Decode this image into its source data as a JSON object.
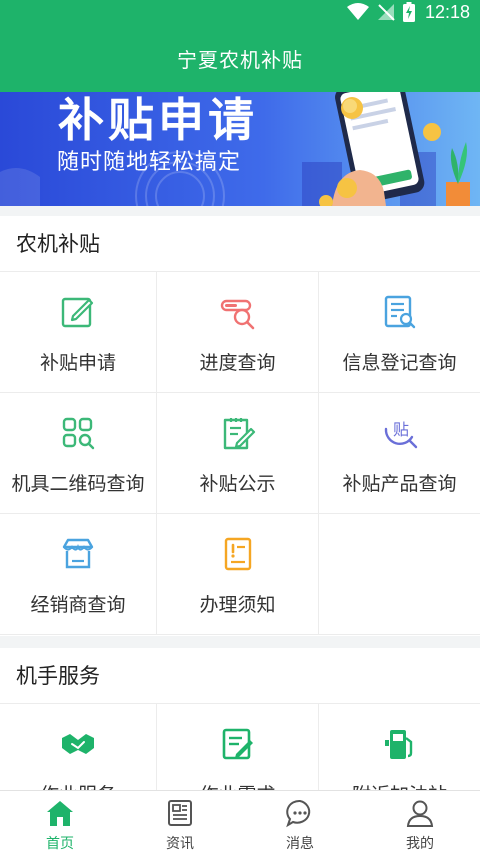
{
  "status_bar": {
    "time": "12:18"
  },
  "app_bar": {
    "title": "宁夏农机补贴"
  },
  "banner": {
    "title": "补贴申请",
    "subtitle": "随时随地轻松搞定"
  },
  "sections": [
    {
      "title": "农机补贴",
      "items": [
        {
          "label": "补贴申请",
          "icon": "edit-icon",
          "color": "#3cb878"
        },
        {
          "label": "进度查询",
          "icon": "progress-search-icon",
          "color": "#f07272"
        },
        {
          "label": "信息登记查询",
          "icon": "record-search-icon",
          "color": "#4aa3df"
        },
        {
          "label": "机具二维码查询",
          "icon": "qrcode-search-icon",
          "color": "#3cb878"
        },
        {
          "label": "补贴公示",
          "icon": "notice-edit-icon",
          "color": "#3cb878"
        },
        {
          "label": "补贴产品查询",
          "icon": "subsidy-product-icon",
          "color": "#6a6fd8"
        },
        {
          "label": "经销商查询",
          "icon": "store-icon",
          "color": "#4aa3df"
        },
        {
          "label": "办理须知",
          "icon": "notice-icon",
          "color": "#f5a623"
        }
      ]
    },
    {
      "title": "机手服务",
      "items": [
        {
          "label": "作业服务",
          "icon": "handshake-icon",
          "color": "#1eb36a"
        },
        {
          "label": "作业需求",
          "icon": "demand-edit-icon",
          "color": "#1eb36a"
        },
        {
          "label": "附近加油站",
          "icon": "fuel-station-icon",
          "color": "#1eb36a"
        }
      ]
    }
  ],
  "tabbar": {
    "items": [
      {
        "label": "首页",
        "icon": "home-icon",
        "active": true
      },
      {
        "label": "资讯",
        "icon": "news-icon",
        "active": false
      },
      {
        "label": "消息",
        "icon": "message-icon",
        "active": false
      },
      {
        "label": "我的",
        "icon": "user-icon",
        "active": false
      }
    ],
    "active_color": "#1eb36a"
  }
}
